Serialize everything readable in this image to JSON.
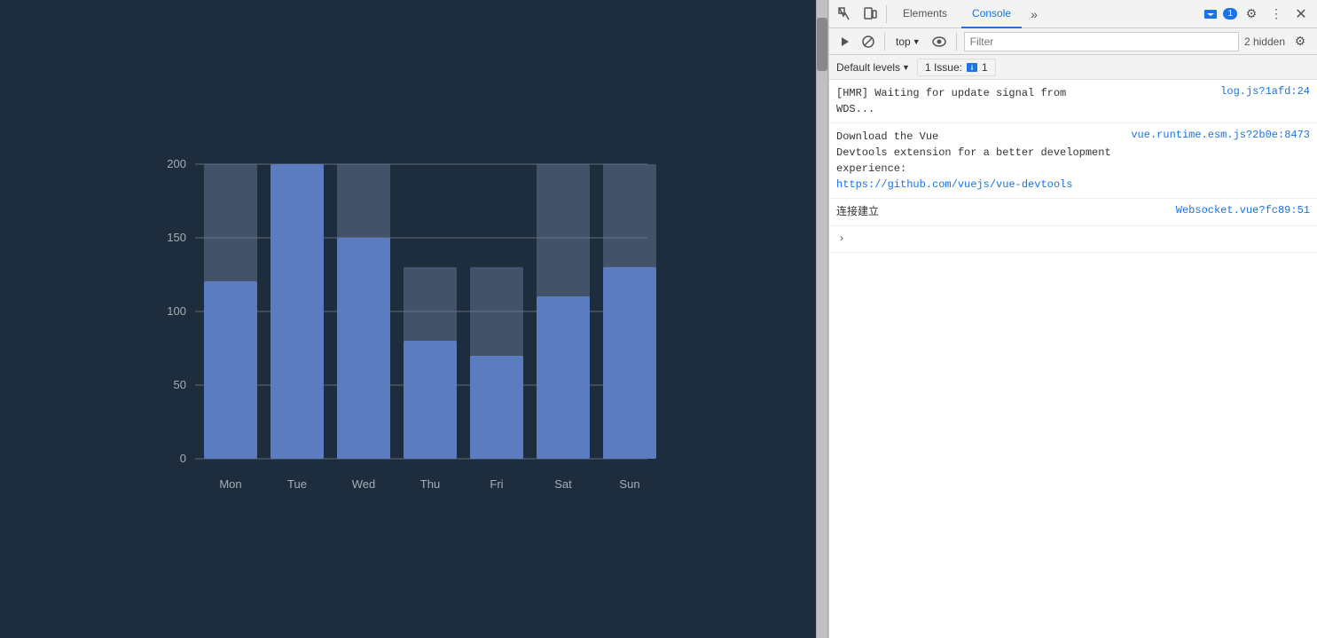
{
  "chart": {
    "background": "#1e2d3d",
    "bars": [
      {
        "day": "Mon",
        "value": 120,
        "bgValue": 200
      },
      {
        "day": "Tue",
        "value": 200,
        "bgValue": 200
      },
      {
        "day": "Wed",
        "value": 150,
        "bgValue": 200
      },
      {
        "day": "Thu",
        "value": 80,
        "bgValue": 130
      },
      {
        "day": "Fri",
        "value": 70,
        "bgValue": 130
      },
      {
        "day": "Sat",
        "value": 110,
        "bgValue": 200
      },
      {
        "day": "Sun",
        "value": 130,
        "bgValue": 200
      }
    ],
    "yLabels": [
      "0",
      "50",
      "100",
      "150",
      "200"
    ],
    "maxValue": 200
  },
  "devtools": {
    "tabs": [
      {
        "label": "Elements",
        "active": false
      },
      {
        "label": "Console",
        "active": true
      }
    ],
    "more_tabs_label": "»",
    "badge_count": "1",
    "settings_icon": "⚙",
    "more_options_icon": "⋮",
    "close_icon": "✕",
    "toolbar2": {
      "play_icon": "▶",
      "block_icon": "🚫",
      "top_label": "top",
      "dropdown_arrow": "▼",
      "eye_icon": "👁",
      "filter_placeholder": "Filter",
      "hidden_text": "2 hidden",
      "settings_icon": "⚙"
    },
    "toolbar3": {
      "default_levels_label": "Default levels",
      "dropdown_arrow": "▼",
      "issue_label": "1 Issue:",
      "issue_badge_count": "1"
    },
    "messages": [
      {
        "id": 1,
        "text": "[HMR] Waiting for update signal from\nWDS...",
        "link_text": "log.js?1afd:24",
        "link_url": "#"
      },
      {
        "id": 2,
        "text": "Download the Vue\nDevtools extension for a better development\nexperience:\nhttps://github.com/vuejs/vue-devtools",
        "link_text": "vue.runtime.esm.js?2b0e:8473",
        "link_url": "#",
        "has_url": true,
        "url_text": "https://github.com/vuejs/vue-devtools"
      },
      {
        "id": 3,
        "text": "连接建立",
        "link_text": "Websocket.vue?fc89:51",
        "link_url": "#"
      }
    ],
    "expand_entry": {
      "symbol": "›"
    }
  }
}
